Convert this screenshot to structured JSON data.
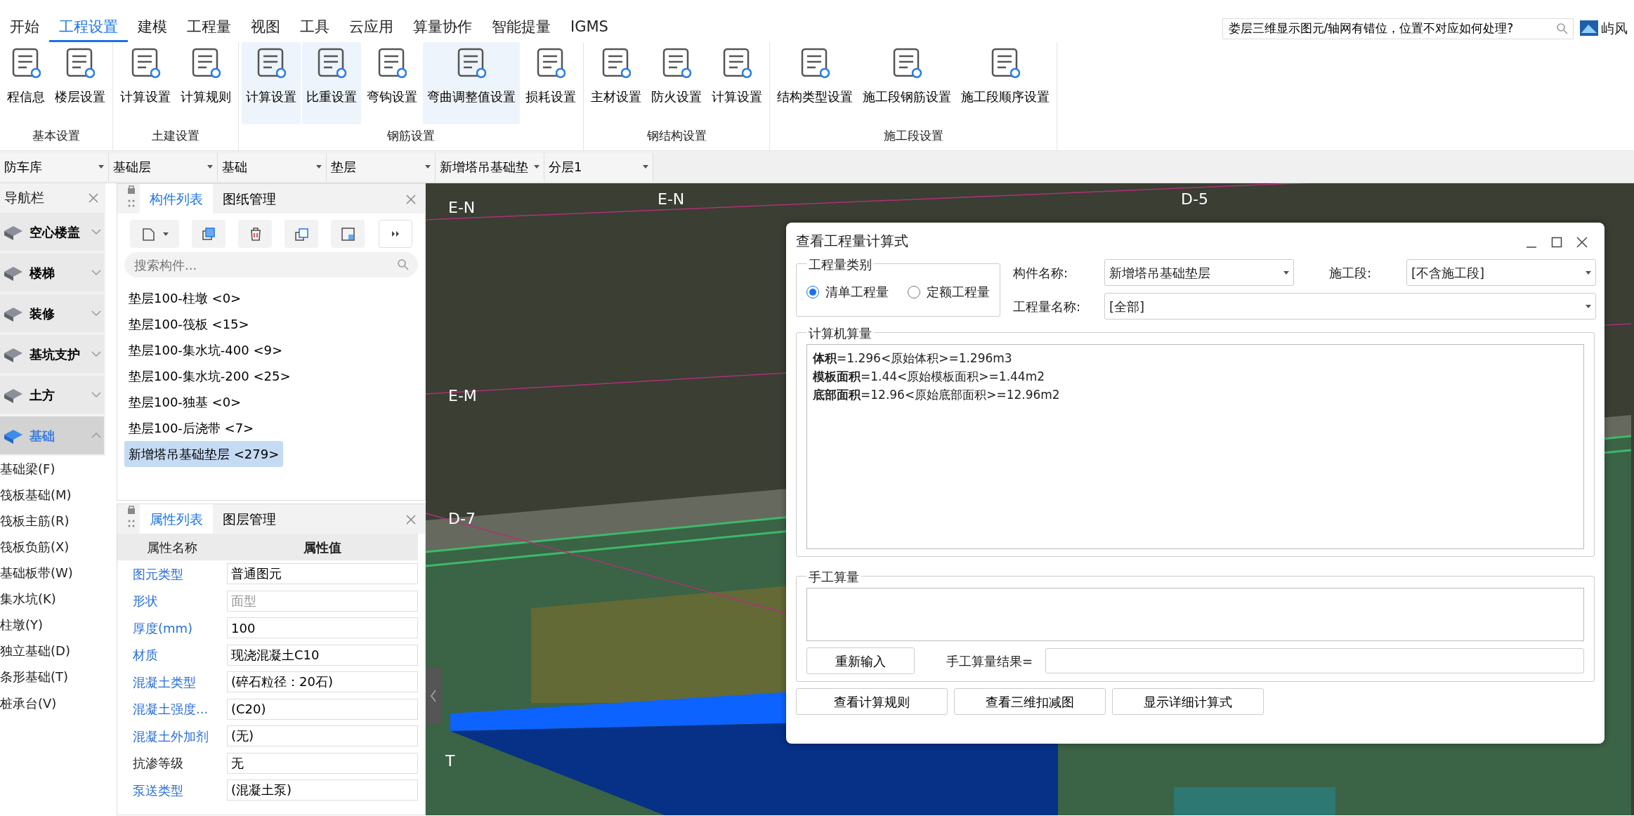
{
  "menu_tabs": [
    {
      "label": "开始",
      "selected": false
    },
    {
      "label": "工程设置",
      "selected": true
    },
    {
      "label": "建模",
      "selected": false
    },
    {
      "label": "工程量",
      "selected": false
    },
    {
      "label": "视图",
      "selected": false
    },
    {
      "label": "工具",
      "selected": false
    },
    {
      "label": "云应用",
      "selected": false
    },
    {
      "label": "算量协作",
      "selected": false
    },
    {
      "label": "智能提量",
      "selected": false
    },
    {
      "label": "IGMS",
      "selected": false
    }
  ],
  "help_search": {
    "value": "娄层三维显示图元/轴网有错位，位置不对应如何处理?"
  },
  "user": {
    "name": "屿风"
  },
  "ribbon_groups": [
    {
      "label": "基本设置",
      "buttons": [
        {
          "label": "程信息",
          "highlighted": false
        },
        {
          "label": "楼层设置",
          "highlighted": false
        }
      ]
    },
    {
      "label": "土建设置",
      "buttons": [
        {
          "label": "计算设置",
          "highlighted": false
        },
        {
          "label": "计算规则",
          "highlighted": false
        }
      ]
    },
    {
      "label": "钢筋设置",
      "buttons": [
        {
          "label": "计算设置",
          "highlighted": true
        },
        {
          "label": "比重设置",
          "highlighted": true
        },
        {
          "label": "弯钩设置",
          "highlighted": false
        },
        {
          "label": "弯曲调整值设置",
          "highlighted": true
        },
        {
          "label": "损耗设置",
          "highlighted": false
        }
      ]
    },
    {
      "label": "钢结构设置",
      "buttons": [
        {
          "label": "主材设置",
          "highlighted": false
        },
        {
          "label": "防火设置",
          "highlighted": false
        },
        {
          "label": "计算设置",
          "highlighted": false
        }
      ]
    },
    {
      "label": "施工段设置",
      "buttons": [
        {
          "label": "结构类型设置",
          "highlighted": false
        },
        {
          "label": "施工段钢筋设置",
          "highlighted": false
        },
        {
          "label": "施工段顺序设置",
          "highlighted": false
        }
      ]
    }
  ],
  "filter_dropdowns": [
    "防车库",
    "基础层",
    "基础",
    "垫层",
    "新增塔吊基础垫",
    "分层1"
  ],
  "nav_panel": {
    "title": "导航栏",
    "categories": [
      {
        "label": "空心楼盖",
        "expanded": false
      },
      {
        "label": "楼梯",
        "expanded": false
      },
      {
        "label": "装修",
        "expanded": false
      },
      {
        "label": "基坑支护",
        "expanded": false
      },
      {
        "label": "土方",
        "expanded": false
      },
      {
        "label": "基础",
        "expanded": true
      }
    ],
    "items": [
      "基础梁(F)",
      "筏板基础(M)",
      "筏板主筋(R)",
      "筏板负筋(X)",
      "基础板带(W)",
      "集水坑(K)",
      "柱墩(Y)",
      "独立基础(D)",
      "条形基础(T)",
      "桩承台(V)"
    ]
  },
  "component_panel": {
    "tabs": [
      {
        "label": "构件列表",
        "selected": true
      },
      {
        "label": "图纸管理",
        "selected": false
      }
    ],
    "search": {
      "placeholder": "搜索构件..."
    },
    "items": [
      {
        "label": "垫层100-柱墩 <0>",
        "selected": false
      },
      {
        "label": "垫层100-筏板 <15>",
        "selected": false
      },
      {
        "label": "垫层100-集水坑-400 <9>",
        "selected": false
      },
      {
        "label": "垫层100-集水坑-200 <25>",
        "selected": false
      },
      {
        "label": "垫层100-独基 <0>",
        "selected": false
      },
      {
        "label": "垫层100-后浇带 <7>",
        "selected": false
      },
      {
        "label": "新增塔吊基础垫层 <279>",
        "selected": true
      }
    ]
  },
  "property_panel": {
    "tabs": [
      {
        "label": "属性列表",
        "selected": true
      },
      {
        "label": "图层管理",
        "selected": false
      }
    ],
    "columns": [
      "属性名称",
      "属性值"
    ],
    "rows": [
      {
        "name": "图元类型",
        "value": "普通图元",
        "public": true,
        "disabled": false
      },
      {
        "name": "形状",
        "value": "面型",
        "public": true,
        "disabled": true
      },
      {
        "name": "厚度(mm)",
        "value": "100",
        "public": true,
        "disabled": false
      },
      {
        "name": "材质",
        "value": "现浇混凝土C10",
        "public": true,
        "disabled": false
      },
      {
        "name": "混凝土类型",
        "value": "(碎石粒径：20石)",
        "public": true,
        "disabled": false
      },
      {
        "name": "混凝土强度...",
        "value": "(C20)",
        "public": true,
        "disabled": false
      },
      {
        "name": "混凝土外加剂",
        "value": "(无)",
        "public": true,
        "disabled": false
      },
      {
        "name": "抗渗等级",
        "value": "无",
        "public": false,
        "disabled": false
      },
      {
        "name": "泵送类型",
        "value": "(混凝土泵)",
        "public": true,
        "disabled": false
      }
    ]
  },
  "viewport": {
    "axis_labels": [
      "E-N",
      "E-N",
      "D-5",
      "E-M",
      "D-7",
      "T"
    ]
  },
  "dialog": {
    "title": "查看工程量计算式",
    "category": {
      "legend": "工程量类别",
      "options": [
        {
          "label": "清单工程量",
          "selected": true
        },
        {
          "label": "定额工程量",
          "selected": false
        }
      ]
    },
    "component_name": {
      "label": "构件名称:",
      "value": "新增塔吊基础垫层"
    },
    "stage": {
      "label": "施工段:",
      "value": "[不含施工段]"
    },
    "quantity_name": {
      "label": "工程量名称:",
      "value": "[全部]"
    },
    "computer": {
      "legend": "计算机算量",
      "lines": [
        "**体积**=1.296<原始体积>=1.296m3",
        "**模板面积**=1.44<原始模板面积>=1.44m2",
        "**底部面积**=12.96<原始底部面积>=12.96m2"
      ]
    },
    "manual": {
      "legend": "手工算量",
      "reset_button": "重新输入",
      "result_label": "手工算量结果="
    },
    "buttons": [
      "查看计算规则",
      "查看三维扣减图",
      "显示详细计算式"
    ]
  }
}
